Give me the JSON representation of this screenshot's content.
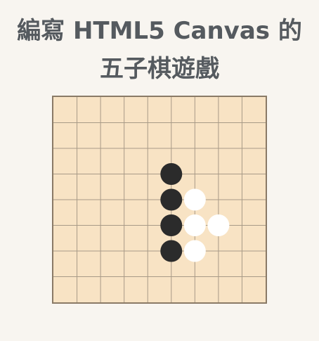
{
  "title": {
    "line1": "編寫 HTML5 Canvas 的",
    "line2": "五子棋遊戲"
  },
  "board": {
    "cols": 9,
    "rows": 8,
    "board_color": "#f8e3c4",
    "line_color": "#a89a87",
    "stones": [
      {
        "col": 4,
        "row": 2,
        "color": "black"
      },
      {
        "col": 4,
        "row": 3,
        "color": "black"
      },
      {
        "col": 4,
        "row": 4,
        "color": "black"
      },
      {
        "col": 4,
        "row": 5,
        "color": "black"
      },
      {
        "col": 5,
        "row": 3,
        "color": "white"
      },
      {
        "col": 5,
        "row": 4,
        "color": "white"
      },
      {
        "col": 6,
        "row": 4,
        "color": "white"
      },
      {
        "col": 5,
        "row": 5,
        "color": "white"
      }
    ]
  }
}
